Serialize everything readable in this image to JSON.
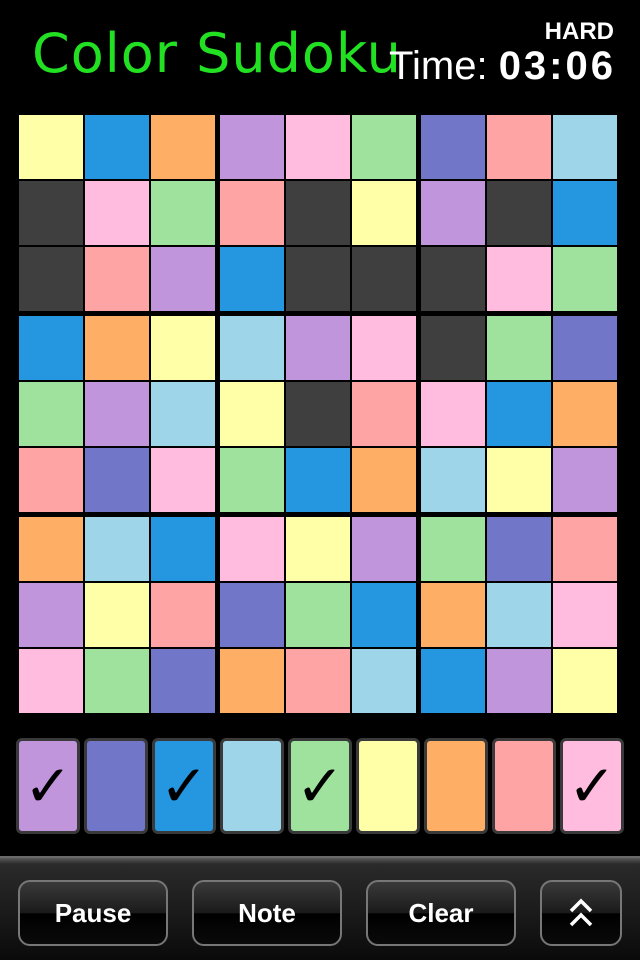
{
  "header": {
    "title": "Color Sudoku",
    "difficulty": "HARD",
    "time_label": "Time:",
    "time_value": "03:06"
  },
  "colors": {
    "Y": "#ffffa8",
    "B": "#2596e0",
    "O": "#ffae66",
    "V": "#c095dc",
    "P": "#ffbcdf",
    "G": "#9fe29d",
    "I": "#7176c8",
    "S": "#ffa4a4",
    "L": "#9fd5e8",
    "D": "#3f3f3f"
  },
  "board": [
    [
      "Y",
      "B",
      "O",
      "V",
      "P",
      "G",
      "I",
      "S",
      "L"
    ],
    [
      "D",
      "P",
      "G",
      "S",
      "D",
      "Y",
      "V",
      "D",
      "B"
    ],
    [
      "D",
      "S",
      "V",
      "B",
      "D",
      "D",
      "D",
      "P",
      "G"
    ],
    [
      "B",
      "O",
      "Y",
      "L",
      "V",
      "P",
      "D",
      "G",
      "I"
    ],
    [
      "G",
      "V",
      "L",
      "Y",
      "D",
      "S",
      "P",
      "B",
      "O"
    ],
    [
      "S",
      "I",
      "P",
      "G",
      "B",
      "O",
      "L",
      "Y",
      "V"
    ],
    [
      "O",
      "L",
      "B",
      "P",
      "Y",
      "V",
      "G",
      "I",
      "S"
    ],
    [
      "V",
      "Y",
      "S",
      "I",
      "G",
      "B",
      "O",
      "L",
      "P"
    ],
    [
      "P",
      "G",
      "I",
      "O",
      "S",
      "L",
      "B",
      "V",
      "Y"
    ]
  ],
  "palette": [
    {
      "color": "V",
      "check": "✓"
    },
    {
      "color": "I",
      "check": ""
    },
    {
      "color": "B",
      "check": "✓"
    },
    {
      "color": "L",
      "check": ""
    },
    {
      "color": "G",
      "check": "✓"
    },
    {
      "color": "Y",
      "check": ""
    },
    {
      "color": "O",
      "check": ""
    },
    {
      "color": "S",
      "check": ""
    },
    {
      "color": "P",
      "check": "✓"
    }
  ],
  "toolbar": {
    "pause_label": "Pause",
    "note_label": "Note",
    "clear_label": "Clear",
    "more_icon": "double-chevron-up-icon"
  }
}
